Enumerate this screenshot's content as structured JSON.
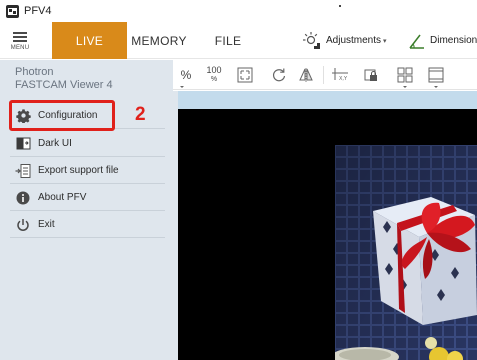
{
  "window": {
    "title": "PFV4"
  },
  "ribbon": {
    "menu_label": "MENU",
    "tabs": [
      {
        "label": "LIVE",
        "active": true
      },
      {
        "label": "MEMORY",
        "active": false
      },
      {
        "label": "FILE",
        "active": false
      }
    ],
    "adjustments_label": "Adjustments",
    "dimension_label": "Dimension"
  },
  "sidebar": {
    "brand_line1": "Photron",
    "brand_line2": "FASTCAM Viewer 4",
    "items": [
      {
        "label": "Configuration",
        "icon": "gear-icon"
      },
      {
        "label": "Dark UI",
        "icon": "dark-ui-icon"
      },
      {
        "label": "Export support file",
        "icon": "export-file-icon"
      },
      {
        "label": "About PFV",
        "icon": "info-icon"
      },
      {
        "label": "Exit",
        "icon": "power-icon"
      }
    ]
  },
  "annotation": {
    "step_number": "2"
  },
  "toolbar": {
    "percent_label": "%",
    "zoom100_number": "100",
    "zoom100_percent": "%"
  },
  "colors": {
    "accent_orange": "#d98a1a",
    "sidebar_bg": "#dfe6ed",
    "highlight_red": "#e0211b",
    "strip_blue": "#c3dbec"
  }
}
